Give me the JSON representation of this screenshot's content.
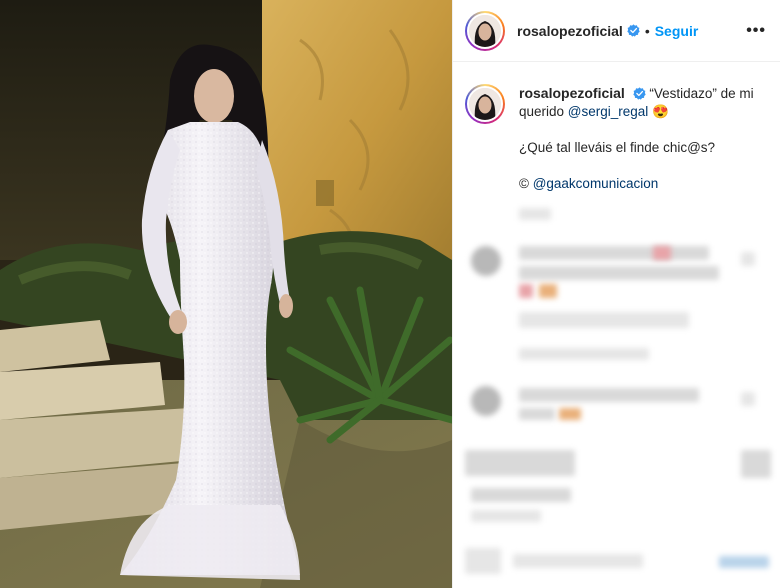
{
  "post": {
    "username": "rosalopezoficial",
    "separator": "•",
    "follow_label": "Seguir",
    "more_label": "•••",
    "caption": {
      "part1": "“Vestidazo” de mi querido ",
      "mention_stylist": "@sergi_regal",
      "emoji": "😍",
      "line2": "¿Qué tal lleváis el finde chic@s?",
      "credit_prefix": "© ",
      "mention_credit": "@gaakcomunicacion"
    }
  },
  "icons": {
    "verified": "verified-badge-icon",
    "more": "more-options-icon",
    "emoji": "heart-eyes-emoji-icon"
  },
  "colors": {
    "follow_blue": "#0095f6",
    "mention_blue": "#00376b",
    "verified_blue": "#3897f0",
    "story_ring": "#d62976"
  }
}
